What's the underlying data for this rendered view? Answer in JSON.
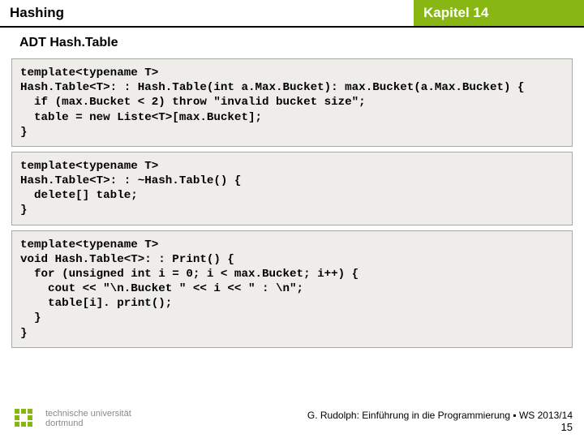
{
  "header": {
    "left": "Hashing",
    "right": "Kapitel 14"
  },
  "subtitle": "ADT Hash.Table",
  "code1": "template<typename T>\nHash.Table<T>: : Hash.Table(int a.Max.Bucket): max.Bucket(a.Max.Bucket) {\n  if (max.Bucket < 2) throw \"invalid bucket size\";\n  table = new Liste<T>[max.Bucket];\n}",
  "code2": "template<typename T>\nHash.Table<T>: : ~Hash.Table() {\n  delete[] table;\n}",
  "code3": "template<typename T>\nvoid Hash.Table<T>: : Print() {\n  for (unsigned int i = 0; i < max.Bucket; i++) {\n    cout << \"\\n.Bucket \" << i << \" : \\n\";\n    table[i]. print();\n  }\n}",
  "footer": {
    "uni1": "technische universität",
    "uni2": "dortmund",
    "credit": "G. Rudolph: Einführung in die Programmierung ▪ WS 2013/14",
    "page": "15"
  }
}
